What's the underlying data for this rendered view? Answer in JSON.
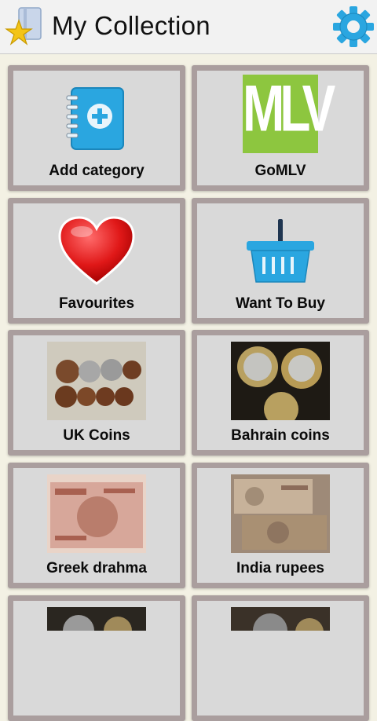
{
  "app_bar": {
    "title": "My Collection",
    "settings_icon": "gear-icon",
    "app_icon": "star-book-icon"
  },
  "tiles": [
    {
      "label": "Add category",
      "icon": "add-book-icon"
    },
    {
      "label": "GoMLV",
      "icon": "mlv-logo",
      "logo_text": "MLV"
    },
    {
      "label": "Favourites",
      "icon": "heart-icon"
    },
    {
      "label": "Want To Buy",
      "icon": "basket-icon"
    },
    {
      "label": "UK Coins",
      "icon": "coins-photo"
    },
    {
      "label": "Bahrain coins",
      "icon": "coins-photo"
    },
    {
      "label": "Greek drahma",
      "icon": "banknote-photo"
    },
    {
      "label": "India rupees",
      "icon": "banknote-photo"
    },
    {
      "label": "",
      "icon": "coins-photo"
    },
    {
      "label": "",
      "icon": "coins-photo"
    }
  ],
  "colors": {
    "background": "#f3f1e4",
    "tile_border": "#aa9e9e",
    "tile_fill": "#d9d9d9",
    "mlv_green": "#8dc63f",
    "accent_blue": "#2aa6e0"
  }
}
